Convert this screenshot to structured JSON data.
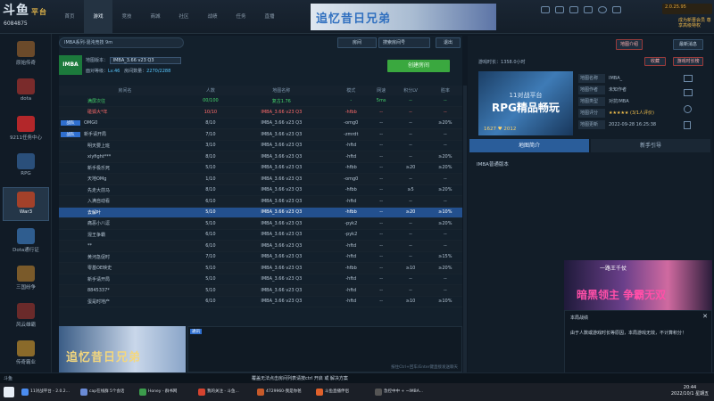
{
  "app": {
    "logo": "斗鱼",
    "logo_sub": "平台",
    "user_id": "6084875"
  },
  "nav": [
    "首页",
    "游戏",
    "竞技",
    "商城",
    "社区",
    "战绩",
    "任务",
    "直播"
  ],
  "nav_active": 1,
  "top_banner": "追忆昔日兄弟",
  "top_right": {
    "vip_text": "2.0.25.95",
    "promo": "成为新晋会员\n尊享高级特权"
  },
  "sidebar": [
    {
      "label": "原始传奇",
      "color": "#6b4a2a"
    },
    {
      "label": "dota",
      "color": "#7a2b2b"
    },
    {
      "label": "9211任务中心",
      "color": "#b3272a"
    },
    {
      "label": "RPG",
      "color": "#2a4f7a"
    },
    {
      "label": "War3",
      "color": "#a3412a"
    },
    {
      "label": "Dota通行证",
      "color": "#2f5d8f"
    },
    {
      "label": "三国纷争",
      "color": "#7a5a2a"
    },
    {
      "label": "风云雄霸",
      "color": "#6a2a2a"
    },
    {
      "label": "传奇霸业",
      "color": "#8a6a2a"
    }
  ],
  "room": {
    "tab_label": "IMBA系列-混沌竞技",
    "tab_count": "9m",
    "room_btn": "房间",
    "search_placeholder": "搜索房间号",
    "exit_btn": "退出",
    "logo_text": "IMBA",
    "map_version_label": "地图版本：",
    "map_version": "IMBA_3.66 v23 Q3",
    "level_label": "面对等级：",
    "level": "Lv.46",
    "room_count_label": "房间数量：",
    "room_count": "2270/2288",
    "create_btn": "创建房间"
  },
  "table": {
    "headers": [
      "房间名",
      "人数",
      "地图名称",
      "模式",
      "网速",
      "积分LV",
      "胜率"
    ],
    "rows": [
      {
        "tag": "",
        "name": "满屏次往",
        "count": "00/100",
        "map": "复古1.76",
        "mode": "-",
        "net": "5ms",
        "lv": "--",
        "win": "--",
        "style": "green"
      },
      {
        "tag": "",
        "name": "碰狐大*年",
        "count": "10/10",
        "map": "IMBA_3.66 v23 Q3",
        "mode": "-hfbb",
        "net": "--",
        "lv": "--",
        "win": "--",
        "style": "red"
      },
      {
        "tag": "战队",
        "name": "OMG0",
        "count": "8/10",
        "map": "IMBA_3.66 v23 Q3",
        "mode": "-omg0",
        "net": "--",
        "lv": "--",
        "win": "≥20%",
        "style": ""
      },
      {
        "tag": "战队",
        "name": "新手请开局",
        "count": "7/10",
        "map": "IMBA_3.66 v23 Q3",
        "mode": "-zmrdt",
        "net": "--",
        "lv": "--",
        "win": "--",
        "style": ""
      },
      {
        "tag": "",
        "name": "明天要上班",
        "count": "3/10",
        "map": "IMBA_3.66 v23 Q3",
        "mode": "-hftd",
        "net": "--",
        "lv": "--",
        "win": "--",
        "style": ""
      },
      {
        "tag": "",
        "name": "xiyfight***",
        "count": "8/10",
        "map": "IMBA_3.66 v23 Q3",
        "mode": "-hftd",
        "net": "--",
        "lv": "--",
        "win": "≥20%",
        "style": ""
      },
      {
        "tag": "",
        "name": "新手极乐死",
        "count": "5/10",
        "map": "IMBA_3.66 v23 Q3",
        "mode": "-hfbb",
        "net": "--",
        "lv": "≥20",
        "win": "≥20%",
        "style": ""
      },
      {
        "tag": "",
        "name": "天地OMg",
        "count": "1/10",
        "map": "IMBA_3.66 v23 Q3",
        "mode": "-omg0",
        "net": "--",
        "lv": "--",
        "win": "--",
        "style": ""
      },
      {
        "tag": "",
        "name": "先走大前马",
        "count": "8/10",
        "map": "IMBA_3.66 v23 Q3",
        "mode": "-hfbb",
        "net": "--",
        "lv": "≥5",
        "win": "≥20%",
        "style": ""
      },
      {
        "tag": "",
        "name": "入满自动看",
        "count": "6/10",
        "map": "IMBA_3.66 v23 Q3",
        "mode": "-hftd",
        "net": "--",
        "lv": "--",
        "win": "--",
        "style": ""
      },
      {
        "tag": "",
        "name": "去解叶",
        "count": "5/10",
        "map": "IMBA_3.66 v23 Q3",
        "mode": "-hfbb",
        "net": "--",
        "lv": "≥20",
        "win": "≥10%",
        "style": "sel"
      },
      {
        "tag": "",
        "name": "痛恶小八逗",
        "count": "5/10",
        "map": "IMBA_3.66 v23 Q3",
        "mode": "-pyk2",
        "net": "--",
        "lv": "--",
        "win": "≥20%",
        "style": ""
      },
      {
        "tag": "",
        "name": "混王争霸",
        "count": "6/10",
        "map": "IMBA_3.66 v23 Q3",
        "mode": "-pyk2",
        "net": "--",
        "lv": "--",
        "win": "--",
        "style": ""
      },
      {
        "tag": "",
        "name": "**",
        "count": "6/10",
        "map": "IMBA_3.66 v23 Q3",
        "mode": "-hftd",
        "net": "--",
        "lv": "--",
        "win": "--",
        "style": ""
      },
      {
        "tag": "",
        "name": "黄河急促时",
        "count": "7/10",
        "map": "IMBA_3.66 v23 Q3",
        "mode": "-hftd",
        "net": "--",
        "lv": "--",
        "win": "≥15%",
        "style": ""
      },
      {
        "tag": "",
        "name": "零基OE映史",
        "count": "5/10",
        "map": "IMBA_3.66 v23 Q3",
        "mode": "-hfbb",
        "net": "--",
        "lv": "≥10",
        "win": "≥20%",
        "style": ""
      },
      {
        "tag": "",
        "name": "新手请开局",
        "count": "5/10",
        "map": "IMBA_3.66 v23 Q3",
        "mode": "-hftd",
        "net": "--",
        "lv": "--",
        "win": "--",
        "style": ""
      },
      {
        "tag": "",
        "name": "8845337*",
        "count": "5/10",
        "map": "IMBA_3.66 v23 Q3",
        "mode": "-hftd",
        "net": "--",
        "lv": "--",
        "win": "--",
        "style": ""
      },
      {
        "tag": "",
        "name": "蛋是时地产",
        "count": "6/10",
        "map": "IMBA_3.66 v23 Q3",
        "mode": "-hftd",
        "net": "--",
        "lv": "≥10",
        "win": "≥10%",
        "style": ""
      }
    ]
  },
  "bottom_banner": "追忆昔日兄弟",
  "chat": {
    "label": "通讯",
    "hint": "按住Ctrl+回车/Enter键直接发送聊天"
  },
  "right": {
    "btn1": "地图介绍",
    "btn2": "最新消息",
    "timer_label": "游戏时长：",
    "timer": "1358.0小时",
    "btn3": "收藏",
    "btn4": "游戏时长榜",
    "map_img_t1": "11对战平台",
    "map_img_t2": "RPG精品畅玩",
    "map_img_t3": "1627 ♥ 2012",
    "info": [
      {
        "k": "地图名称",
        "v": "IMBA_"
      },
      {
        "k": "地图作者",
        "v": "未知作者"
      },
      {
        "k": "地图类型",
        "v": "对抗IMBA"
      },
      {
        "k": "地图评分",
        "v": "★★★★★ (3/1人评价)"
      },
      {
        "k": "地图更新",
        "v": "2022-09-28 16:25:38"
      }
    ],
    "tab_active": "地图简介",
    "tab_other": "新手引导",
    "desc": "IMBA普通版本"
  },
  "video": {
    "overlay": "暗黑领主 争霸无双",
    "title_top": "一路王千仗",
    "panel_title": "本局战绩",
    "panel_text": "由于人数或游戏时长等原因，本局游戏无效，不计算积分！"
  },
  "statusbar": {
    "notice": "覆盖无法点击房间列表请按ctrl 开启 或 解决方案",
    "left": "斗鱼"
  },
  "taskbar": [
    {
      "label": "11对战平台 - 2.0.2...",
      "c": "#4b8cf0"
    },
    {
      "label": "cap在线群 5个会话",
      "c": "#6a8bd6"
    },
    {
      "label": "Honey - 群书网",
      "c": "#3c9c4c"
    },
    {
      "label": "我的关注 - 斗鱼...",
      "c": "#d5432f"
    },
    {
      "label": "4729960-我是你爸",
      "c": "#c75a2a"
    },
    {
      "label": "斗鱼直播伴侣",
      "c": "#e0612b"
    },
    {
      "label": "急控中中 + ~IMBA...",
      "c": "#555"
    }
  ],
  "clock": {
    "time": "20:44",
    "date": "2022/10/1 星期五"
  }
}
